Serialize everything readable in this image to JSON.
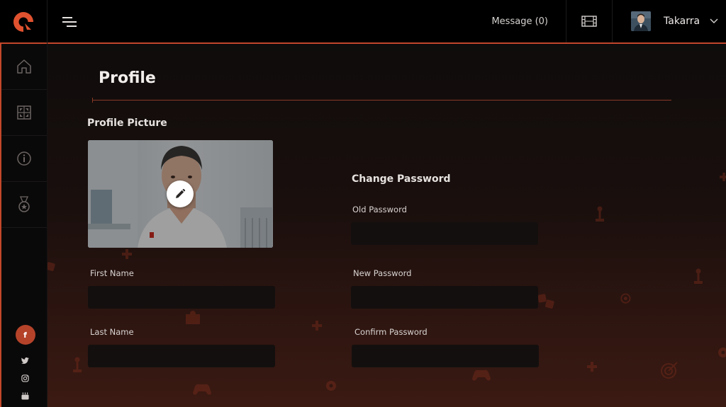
{
  "header": {
    "message_label": "Message (0)",
    "username": "Takarra",
    "icons": [
      "logo-icon",
      "hamburger-menu-icon",
      "film-icon",
      "chevron-down-icon"
    ]
  },
  "sidebar": {
    "items": [
      {
        "icon": "home-icon"
      },
      {
        "icon": "game-board-icon"
      },
      {
        "icon": "info-icon"
      },
      {
        "icon": "medal-icon"
      }
    ],
    "social": [
      {
        "icon": "facebook-icon",
        "glyph": "f"
      },
      {
        "icon": "twitter-icon"
      },
      {
        "icon": "instagram-icon"
      },
      {
        "icon": "youtube-icon"
      }
    ]
  },
  "page": {
    "title": "Profile",
    "profile_picture_label": "Profile Picture",
    "first_name_label": "First Name",
    "first_name_value": "",
    "last_name_label": "Last Name",
    "last_name_value": "",
    "change_password_label": "Change Password",
    "old_password_label": "Old Password",
    "new_password_label": "New Password",
    "confirm_password_label": "Confirm Password"
  },
  "colors": {
    "accent": "#c2472b",
    "topbar_bg": "#000000",
    "input_bg": "#140f0f",
    "page_gradient_bottom": "#3b1a12"
  }
}
